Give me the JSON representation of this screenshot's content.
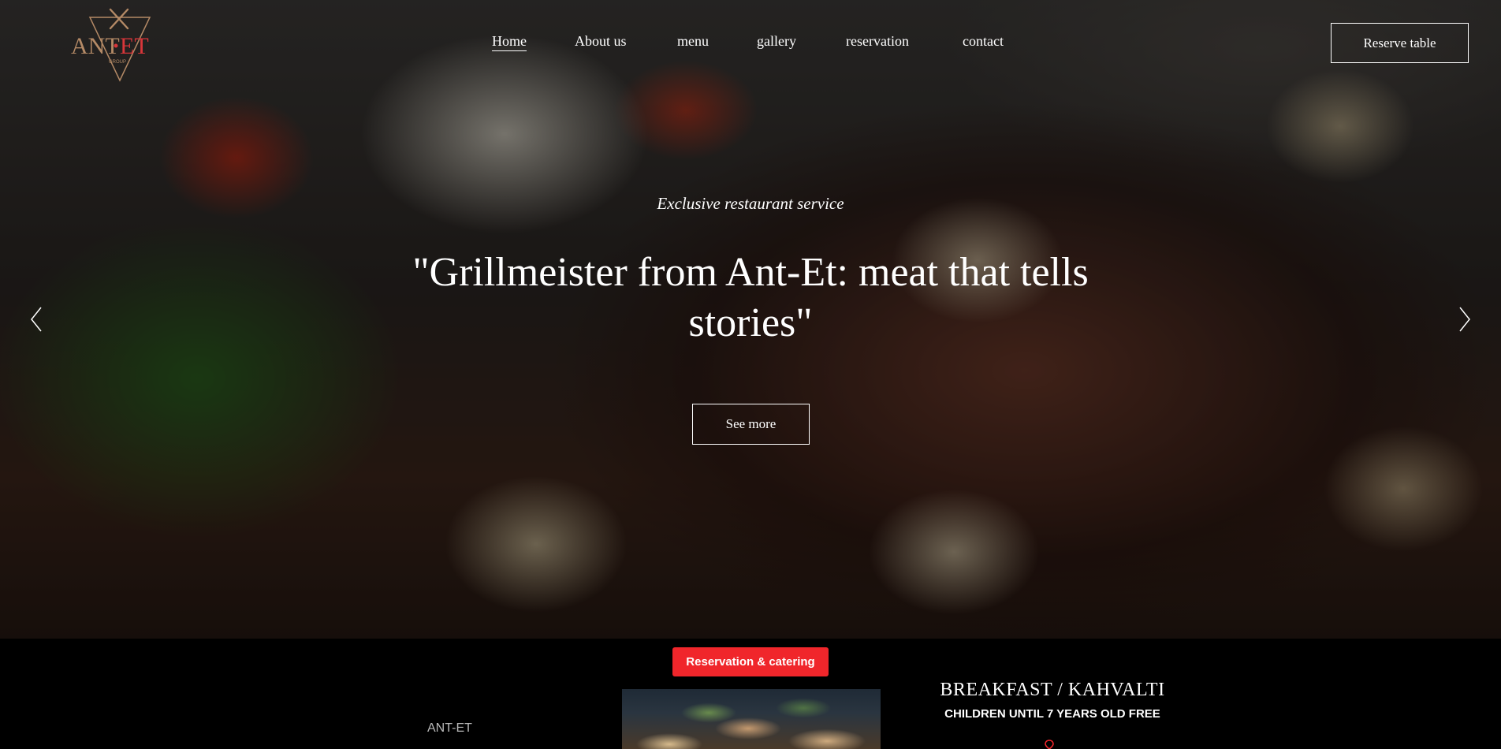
{
  "brand": {
    "logo_text": "ANT•ET",
    "logo_small_text": "GROUP"
  },
  "nav": {
    "items": [
      {
        "label": "Home",
        "active": true
      },
      {
        "label": "About us",
        "active": false
      },
      {
        "label": "menu",
        "active": false
      },
      {
        "label": "gallery",
        "active": false
      },
      {
        "label": "reservation",
        "active": false
      },
      {
        "label": "contact",
        "active": false
      }
    ],
    "reserve_label": "Reserve table"
  },
  "hero": {
    "kicker": "Exclusive restaurant service",
    "headline": "\"Grillmeister from Ant-Et: meat that tells stories\"",
    "cta_label": "See more",
    "prev_icon": "chevron-left-icon",
    "next_icon": "chevron-right-icon"
  },
  "section": {
    "promo_label": "Reservation & catering",
    "brand_label": "ANT-ET",
    "title": "BREAKFAST / KAHVALTI",
    "subtitle": "CHILDREN UNTIL 7 YEARS OLD FREE",
    "pin_icon": "location-pin-icon"
  },
  "colors": {
    "accent": "#f0262b",
    "logo_gold": "#b48a66",
    "logo_red": "#d8363a",
    "text": "#ffffff"
  }
}
